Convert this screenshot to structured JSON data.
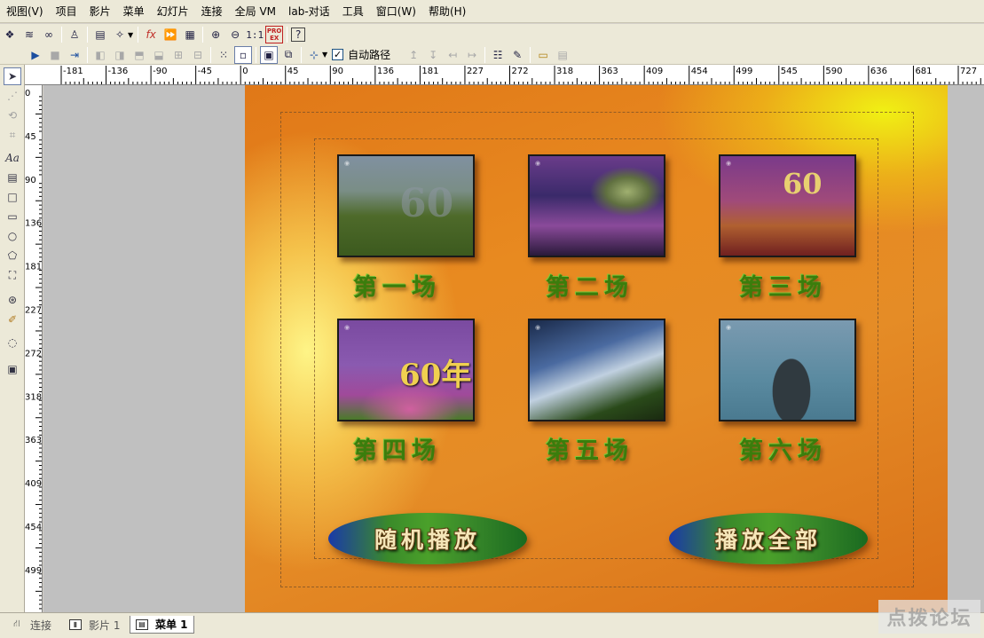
{
  "menubar": {
    "items": [
      {
        "label": "视图(V)"
      },
      {
        "label": "项目"
      },
      {
        "label": "影片"
      },
      {
        "label": "菜单"
      },
      {
        "label": "幻灯片"
      },
      {
        "label": "连接"
      },
      {
        "label": "全局 VM"
      },
      {
        "label": "lab-对话"
      },
      {
        "label": "工具"
      },
      {
        "label": "窗口(W)"
      },
      {
        "label": "帮助(H)"
      }
    ]
  },
  "toolbar": {
    "zoom_actual_label": "1:1",
    "proex_label": "PRO EX",
    "autopath_label": "自动路径",
    "autopath_checked": "✓"
  },
  "rulers": {
    "horizontal_labels": [
      "-181",
      "-136",
      "-90",
      "-45",
      "0",
      "45",
      "90",
      "136",
      "181",
      "227",
      "272",
      "318",
      "363",
      "409",
      "454",
      "499",
      "545",
      "590",
      "636",
      "681",
      "727"
    ],
    "vertical_labels": [
      "0",
      "45",
      "90",
      "136",
      "181",
      "227",
      "272",
      "318",
      "363",
      "409",
      "454",
      "499"
    ]
  },
  "menu_canvas": {
    "scenes": [
      {
        "label": "第一场",
        "thumb_text": "60",
        "theme": "field"
      },
      {
        "label": "第二场",
        "thumb_text": "",
        "theme": "stage"
      },
      {
        "label": "第三场",
        "thumb_text": "60",
        "theme": "party"
      },
      {
        "label": "第四场",
        "thumb_text": "60年",
        "theme": "flowers"
      },
      {
        "label": "第五场",
        "thumb_text": "",
        "theme": "screen"
      },
      {
        "label": "第六场",
        "thumb_text": "",
        "theme": "statue"
      }
    ],
    "buttons": [
      {
        "label": "随机播放"
      },
      {
        "label": "播放全部"
      }
    ]
  },
  "tabs": [
    {
      "label": "连接"
    },
    {
      "label": "影片 1"
    },
    {
      "label": "菜单 1"
    }
  ],
  "watermark": "点拨论坛",
  "colors": {
    "scene_label": "#3b7d0c",
    "canvas_base": "#e58c26",
    "workspace_bg": "#c0c0c0"
  }
}
